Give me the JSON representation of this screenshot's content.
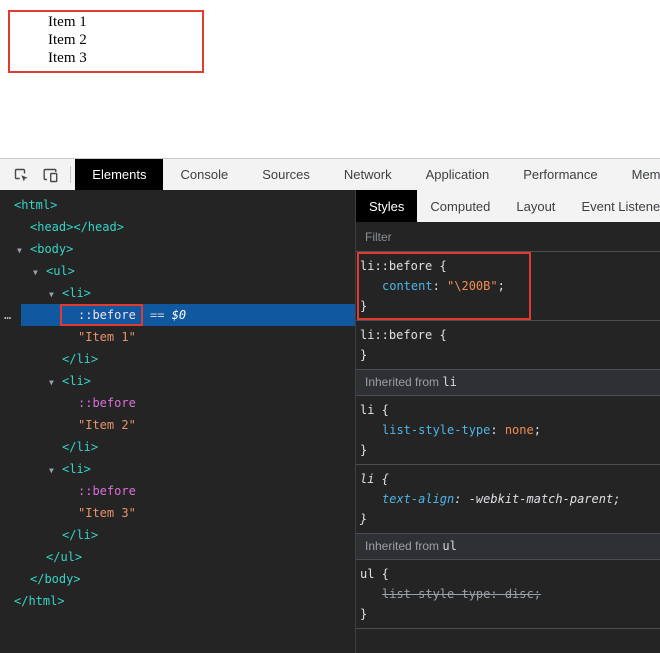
{
  "colors": {
    "annotation_red": "#e03a31",
    "page_bg": "#ffffff",
    "toolbar_bg": "#f3f3f3",
    "toolbar_text": "#3c4043",
    "tab_selected_bg": "#000000",
    "tab_selected_text": "#ffffff",
    "devtools_bg": "#242424",
    "panel_border": "#4a4d51",
    "section_header_bg": "#2f3034",
    "text_muted": "#9aa0a6",
    "text_light": "#dfe1e5",
    "tag_color": "#35d4c7",
    "pseudo_color": "#da70d6",
    "string_color": "#e8936a",
    "property_color": "#4db5e6",
    "value_color": "#f28b54",
    "selection_bg": "#10589f",
    "icon_color": "#4a4a4a"
  },
  "page_preview": {
    "items": [
      "Item 1",
      "Item 2",
      "Item 3"
    ]
  },
  "devtools": {
    "main_tabs": [
      {
        "label": "Elements",
        "selected": true
      },
      {
        "label": "Console",
        "selected": false
      },
      {
        "label": "Sources",
        "selected": false
      },
      {
        "label": "Network",
        "selected": false
      },
      {
        "label": "Application",
        "selected": false
      },
      {
        "label": "Performance",
        "selected": false
      },
      {
        "label": "Memory",
        "selected": false
      }
    ],
    "dom_tree": {
      "lines": [
        {
          "name": "dom-node-html-open",
          "depth": 0,
          "arrow": false,
          "tokens": [
            {
              "t": "tag",
              "v": "<html>"
            }
          ]
        },
        {
          "name": "dom-node-head",
          "depth": 1,
          "arrow": false,
          "tokens": [
            {
              "t": "tag",
              "v": "<head></head>"
            }
          ]
        },
        {
          "name": "dom-node-body-open",
          "depth": 1,
          "arrow": true,
          "tokens": [
            {
              "t": "tag",
              "v": "<body>"
            }
          ]
        },
        {
          "name": "dom-node-ul-open",
          "depth": 2,
          "arrow": true,
          "tokens": [
            {
              "t": "tag",
              "v": "<ul>"
            }
          ]
        },
        {
          "name": "dom-node-li1-open",
          "depth": 3,
          "arrow": true,
          "tokens": [
            {
              "t": "tag",
              "v": "<li>"
            }
          ]
        },
        {
          "name": "dom-node-li1-before",
          "depth": 4,
          "selected": true,
          "dots": true,
          "tokens": [
            {
              "t": "pseudo",
              "v": "::before",
              "redbox": true
            },
            {
              "t": "eq",
              "v": " == "
            },
            {
              "t": "dollar",
              "v": "$0"
            }
          ]
        },
        {
          "name": "dom-node-li1-text",
          "depth": 4,
          "tokens": [
            {
              "t": "string",
              "v": "\"Item 1\""
            }
          ]
        },
        {
          "name": "dom-node-li1-close",
          "depth": 3,
          "tokens": [
            {
              "t": "tag",
              "v": "</li>"
            }
          ]
        },
        {
          "name": "dom-node-li2-open",
          "depth": 3,
          "arrow": true,
          "tokens": [
            {
              "t": "tag",
              "v": "<li>"
            }
          ]
        },
        {
          "name": "dom-node-li2-before",
          "depth": 4,
          "tokens": [
            {
              "t": "pseudo",
              "v": "::before"
            }
          ]
        },
        {
          "name": "dom-node-li2-text",
          "depth": 4,
          "tokens": [
            {
              "t": "string",
              "v": "\"Item 2\""
            }
          ]
        },
        {
          "name": "dom-node-li2-close",
          "depth": 3,
          "tokens": [
            {
              "t": "tag",
              "v": "</li>"
            }
          ]
        },
        {
          "name": "dom-node-li3-open",
          "depth": 3,
          "arrow": true,
          "tokens": [
            {
              "t": "tag",
              "v": "<li>"
            }
          ]
        },
        {
          "name": "dom-node-li3-before",
          "depth": 4,
          "tokens": [
            {
              "t": "pseudo",
              "v": "::before"
            }
          ]
        },
        {
          "name": "dom-node-li3-text",
          "depth": 4,
          "tokens": [
            {
              "t": "string",
              "v": "\"Item 3\""
            }
          ]
        },
        {
          "name": "dom-node-li3-close",
          "depth": 3,
          "tokens": [
            {
              "t": "tag",
              "v": "</li>"
            }
          ]
        },
        {
          "name": "dom-node-ul-close",
          "depth": 2,
          "tokens": [
            {
              "t": "tag",
              "v": "</ul>"
            }
          ]
        },
        {
          "name": "dom-node-body-close",
          "depth": 1,
          "tokens": [
            {
              "t": "tag",
              "v": "</body>"
            }
          ]
        },
        {
          "name": "dom-node-html-close",
          "depth": 0,
          "tokens": [
            {
              "t": "tag",
              "v": "</html>"
            }
          ]
        }
      ]
    },
    "styles_panel": {
      "tabs": [
        {
          "label": "Styles",
          "selected": true
        },
        {
          "label": "Computed",
          "selected": false
        },
        {
          "label": "Layout",
          "selected": false
        },
        {
          "label": "Event Listeners",
          "selected": false
        }
      ],
      "filter_placeholder": "Filter",
      "sections": [
        {
          "type": "rule",
          "name": "rule-li-before-1",
          "redbox": true,
          "selector": "li::before",
          "declarations": [
            {
              "property": "content",
              "value": "\"\\200B\""
            }
          ]
        },
        {
          "type": "rule",
          "name": "rule-li-before-2",
          "selector": "li::before",
          "declarations": []
        },
        {
          "type": "header",
          "name": "inherited-from-li",
          "text": "Inherited from ",
          "element": "li"
        },
        {
          "type": "rule",
          "name": "rule-li-author",
          "selector": "li",
          "declarations": [
            {
              "property": "list-style-type",
              "value": "none"
            }
          ]
        },
        {
          "type": "rule",
          "name": "rule-li-user-agent",
          "italic": true,
          "selector": "li",
          "declarations": [
            {
              "property": "text-align",
              "value": "-webkit-match-parent",
              "plain": true
            }
          ]
        },
        {
          "type": "header",
          "name": "inherited-from-ul",
          "text": "Inherited from ",
          "element": "ul"
        },
        {
          "type": "rule",
          "name": "rule-ul",
          "selector": "ul",
          "declarations": [
            {
              "property": "list-style-type",
              "value": "disc",
              "struck": true
            }
          ]
        }
      ]
    }
  }
}
